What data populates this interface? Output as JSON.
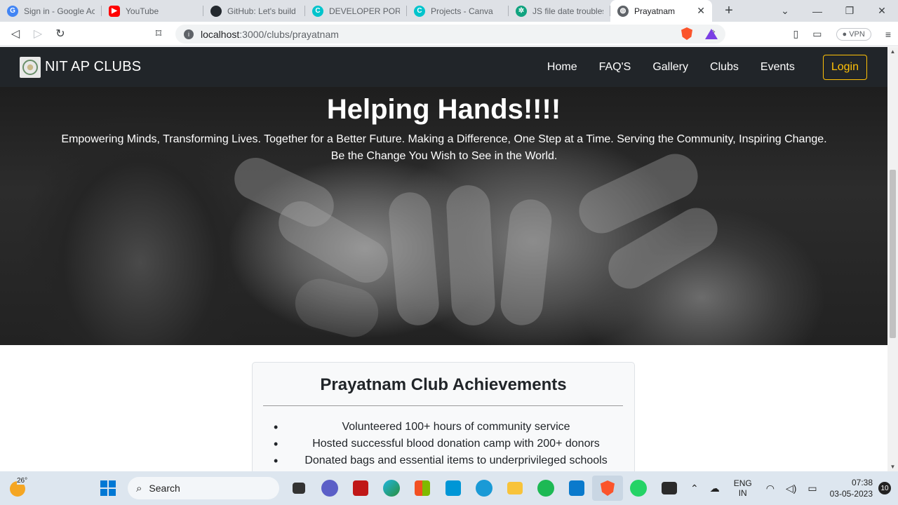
{
  "browser": {
    "tabs": [
      {
        "title": "Sign in - Google Acc",
        "icon": "google-icon",
        "color": "#4285f4"
      },
      {
        "title": "YouTube",
        "icon": "youtube-icon",
        "color": "#ff0000"
      },
      {
        "title": "GitHub: Let's build f",
        "icon": "github-icon",
        "color": "#24292f"
      },
      {
        "title": "DEVELOPER PORTFO",
        "icon": "canva-icon",
        "color": "#00c4cc"
      },
      {
        "title": "Projects - Canva",
        "icon": "canva-icon",
        "color": "#00c4cc"
      },
      {
        "title": "JS file date troublesh",
        "icon": "chatgpt-icon",
        "color": "#10a37f"
      },
      {
        "title": "Prayatnam",
        "icon": "globe-icon",
        "color": "#5f6368"
      }
    ],
    "active_tab": 6,
    "url_host": "localhost",
    "url_path": ":3000/clubs/prayatnam",
    "vpn_label": "VPN"
  },
  "navbar": {
    "brand": "NIT AP CLUBS",
    "links": [
      "Home",
      "FAQ'S",
      "Gallery",
      "Clubs",
      "Events"
    ],
    "login": "Login"
  },
  "hero": {
    "title": "Helping Hands!!!!",
    "subtitle": "Empowering Minds, Transforming Lives. Together for a Better Future. Making a Difference, One Step at a Time. Serving the Community, Inspiring Change. Be the Change You Wish to See in the World."
  },
  "achievements": {
    "title": "Prayatnam Club Achievements",
    "items": [
      "Volunteered 100+ hours of community service",
      "Hosted successful blood donation camp with 200+ donors",
      "Donated bags and essential items to underprivileged schools"
    ]
  },
  "taskbar": {
    "temperature": "26°",
    "search_label": "Search",
    "lang_line1": "ENG",
    "lang_line2": "IN",
    "time": "07:38",
    "date": "03-05-2023",
    "notifications": "10"
  },
  "colors": {
    "navbar_bg": "#212529",
    "login_accent": "#ffc107",
    "card_bg": "#f8f9fa"
  }
}
